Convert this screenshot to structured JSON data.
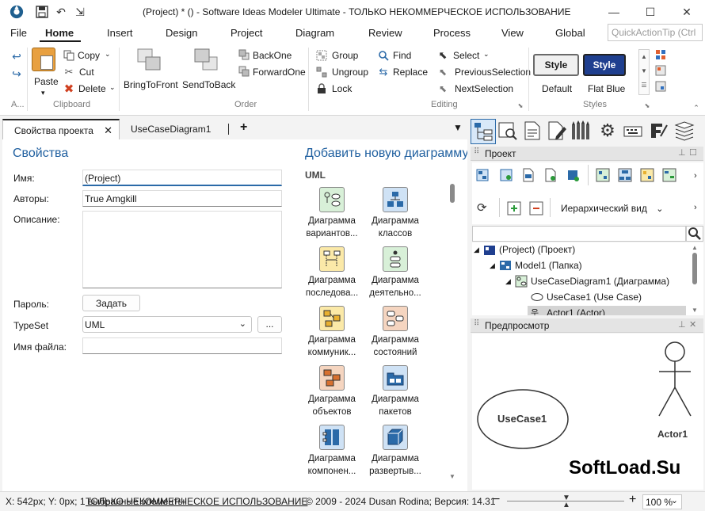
{
  "window": {
    "title": "(Project) *  ()  - Software Ideas Modeler Ultimate - ТОЛЬКО НЕКОММЕРЧЕСКОЕ ИСПОЛЬЗОВАНИЕ",
    "minimize_icon": "minimize-icon",
    "maximize_icon": "maximize-icon",
    "close_icon": "close-icon"
  },
  "menu": {
    "items": [
      "File",
      "Home",
      "Insert",
      "Design",
      "Project",
      "Diagram",
      "Review",
      "Process",
      "View",
      "Global"
    ],
    "active": "Home",
    "quick_placeholder": "QuickActionTip (Ctrl"
  },
  "ribbon": {
    "paste_label": "Paste",
    "copy_label": "Copy",
    "cut_label": "Cut",
    "delete_label": "Delete",
    "clipboard_group": "Clipboard",
    "a_group": "A...",
    "bring_to_front": "BringToFront",
    "send_to_back": "SendToBack",
    "back_one": "BackOne",
    "forward_one": "ForwardOne",
    "order_group": "Order",
    "group_label": "Group",
    "ungroup_label": "Ungroup",
    "lock_label": "Lock",
    "find_label": "Find",
    "replace_label": "Replace",
    "select_label": "Select",
    "previous_selection": "PreviousSelection",
    "next_selection": "NextSelection",
    "editing_group": "Editing",
    "style_btn_1": "Style",
    "style_btn_2": "Style",
    "style_default": "Default",
    "style_flat_blue": "Flat Blue",
    "styles_group": "Styles"
  },
  "tabs": {
    "props_tab": "Свойства проекта",
    "ucd_tab": "UseCaseDiagram1",
    "add_tab": "+"
  },
  "properties": {
    "heading": "Свойства",
    "name_label": "Имя:",
    "name_value": "(Project)",
    "authors_label": "Авторы:",
    "authors_value": "True Amgkill",
    "description_label": "Описание:",
    "password_label": "Пароль:",
    "password_button": "Задать",
    "typeset_label": "TypeSet",
    "typeset_value": "UML",
    "typeset_more": "...",
    "filename_label": "Имя файла:"
  },
  "new_diagram": {
    "heading": "Добавить новую диаграмму.",
    "category": "UML",
    "items": [
      {
        "line1": "Диаграмма",
        "line2": "вариантов..."
      },
      {
        "line1": "Диаграмма",
        "line2": "классов"
      },
      {
        "line1": "Диаграмма",
        "line2": "последова..."
      },
      {
        "line1": "Диаграмма",
        "line2": "деятельно..."
      },
      {
        "line1": "Диаграмма",
        "line2": "коммуник..."
      },
      {
        "line1": "Диаграмма",
        "line2": "состояний"
      },
      {
        "line1": "Диаграмма",
        "line2": "объектов"
      },
      {
        "line1": "Диаграмма",
        "line2": "пакетов"
      },
      {
        "line1": "Диаграмма",
        "line2": "компонен..."
      },
      {
        "line1": "Диаграмма",
        "line2": "развертыв..."
      }
    ]
  },
  "project_panel": {
    "title": "Проект",
    "view_mode": "Иерархический вид",
    "tree": [
      {
        "label": "(Project) (Проект)"
      },
      {
        "label": "Model1 (Папка)"
      },
      {
        "label": "UseCaseDiagram1 (Диаграмма)"
      },
      {
        "label": "UseCase1 (Use Case)"
      },
      {
        "label": "Actor1 (Actor)"
      }
    ]
  },
  "preview_panel": {
    "title": "Предпросмотр",
    "usecase_label": "UseCase1",
    "actor_label": "Actor1",
    "watermark": "SoftLoad.Su"
  },
  "statusbar": {
    "coords": "X: 542px; Y: 0px; 1 выбранные элементы",
    "license": "ТОЛЬКО НЕКОММЕРЧЕСКОЕ ИСПОЛЬЗОВАНИЕ",
    "copyright": "© 2009 - 2024 Dusan Rodina; Версия: 14.31",
    "zoom": "100 %",
    "zoom_level_percent": 100
  }
}
